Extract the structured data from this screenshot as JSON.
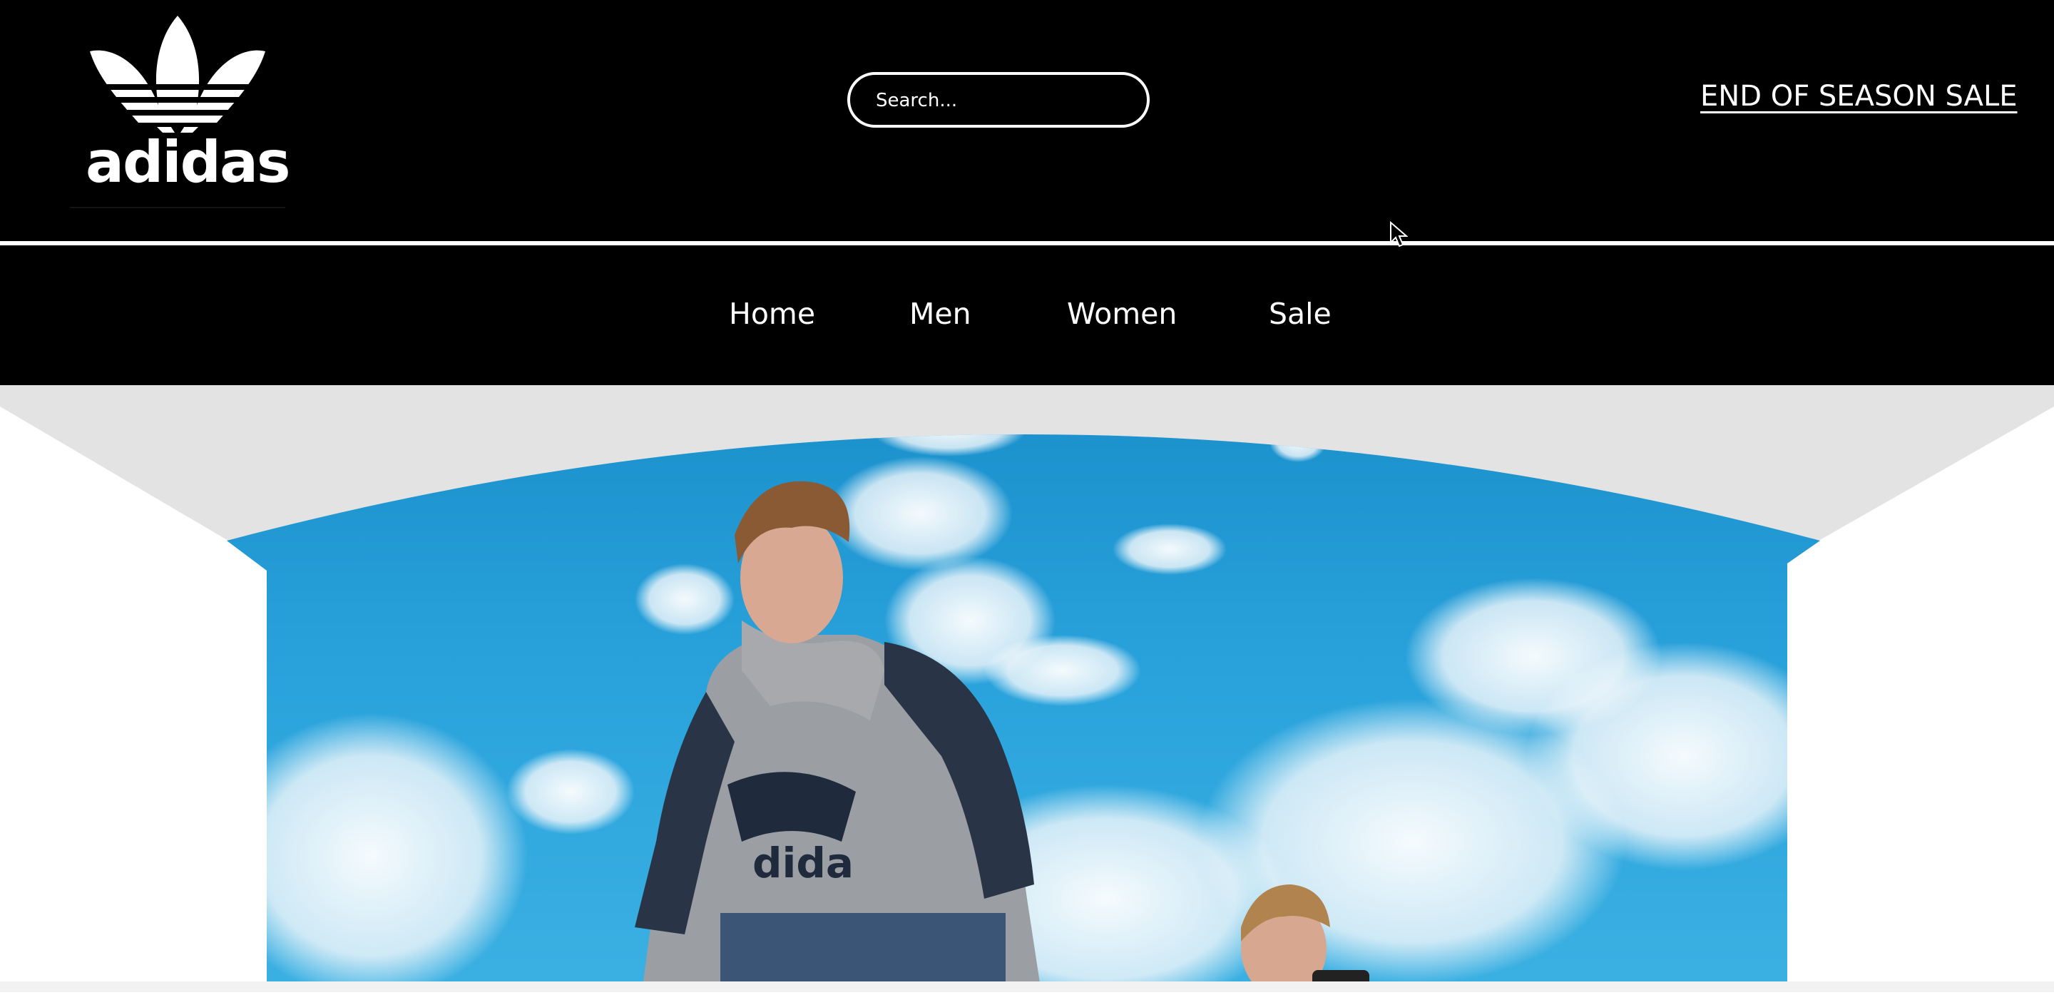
{
  "brand": {
    "name": "adidas",
    "logo_icon": "trefoil-icon"
  },
  "search": {
    "placeholder": "Search..."
  },
  "promo": {
    "label": "END OF SEASON SALE"
  },
  "nav": {
    "items": [
      {
        "label": "Home"
      },
      {
        "label": "Men"
      },
      {
        "label": "Women"
      },
      {
        "label": "Sale"
      }
    ]
  },
  "hero": {
    "image": "two-boys-sky-photo",
    "colors": {
      "sky": "#1E9AD2",
      "frame": "#E3E3E3"
    }
  },
  "colors": {
    "header_bg": "#000000",
    "text": "#FFFFFF"
  }
}
